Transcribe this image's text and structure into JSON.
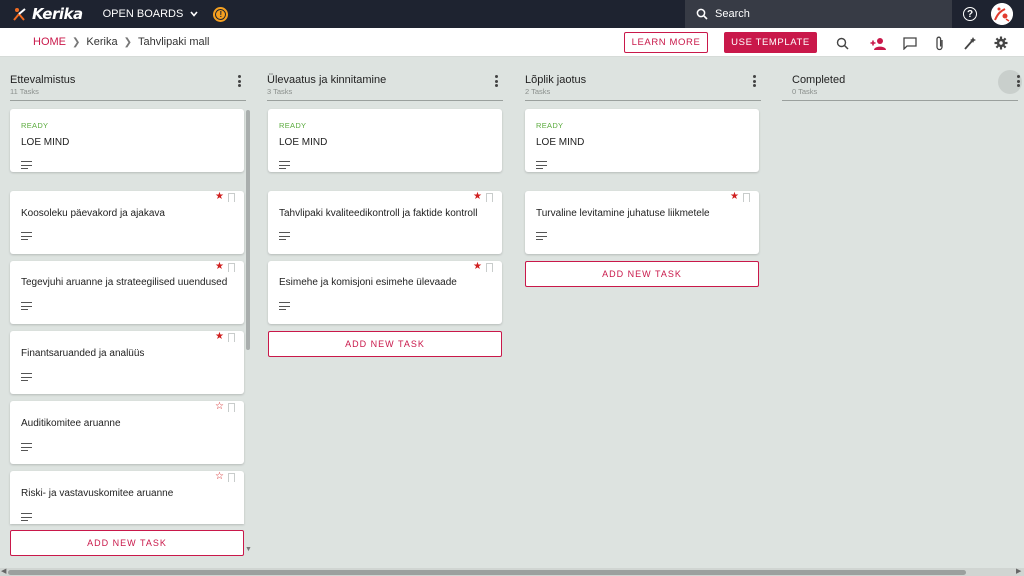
{
  "app": {
    "logo_text": "Kerika",
    "open_boards_label": "OPEN BOARDS",
    "search_placeholder": "Search",
    "help_icon": "help-circle-icon",
    "avatar_icon": "user-avatar"
  },
  "breadcrumb": [
    "HOME",
    "Kerika",
    "Tahvlipaki mall"
  ],
  "buttons": {
    "learn_more": "LEARN MORE",
    "use_template": "USE TEMPLATE"
  },
  "toolbar_icons": [
    "search-icon",
    "add-person-icon",
    "chat-icon",
    "attachment-icon",
    "magic-wand-icon",
    "settings-icon"
  ],
  "colors": {
    "accent": "#c9184a",
    "topbar": "#1e2330",
    "board_bg": "#dde3e0",
    "ready": "#5bab3e"
  },
  "columns": [
    {
      "title": "Ettevalmistus",
      "count": "11 Tasks",
      "add_label": "ADD NEW TASK",
      "cards": [
        {
          "status": "READY",
          "title": "LOE MIND",
          "starred": null
        },
        {
          "status": "",
          "title": "Koosoleku päevakord ja ajakava",
          "starred": true
        },
        {
          "status": "",
          "title": "Tegevjuhi aruanne ja strateegilised uuendused",
          "starred": true
        },
        {
          "status": "",
          "title": "Finantsaruanded ja analüüs",
          "starred": true
        },
        {
          "status": "",
          "title": "Auditikomitee aruanne",
          "starred": false
        },
        {
          "status": "",
          "title": "Riski- ja vastavuskomitee aruanne",
          "starred": false
        }
      ]
    },
    {
      "title": "Ülevaatus ja kinnitamine",
      "count": "3 Tasks",
      "add_label": "ADD NEW TASK",
      "cards": [
        {
          "status": "READY",
          "title": "LOE MIND",
          "starred": null
        },
        {
          "status": "",
          "title": "Tahvlipaki kvaliteedikontroll ja faktide kontroll",
          "starred": true
        },
        {
          "status": "",
          "title": "Esimehe ja komisjoni esimehe ülevaade",
          "starred": true
        }
      ]
    },
    {
      "title": "Lõplik jaotus",
      "count": "2 Tasks",
      "add_label": "ADD NEW TASK",
      "cards": [
        {
          "status": "READY",
          "title": "LOE MIND",
          "starred": null
        },
        {
          "status": "",
          "title": "Turvaline levitamine juhatuse liikmetele",
          "starred": true
        }
      ]
    },
    {
      "title": "Completed",
      "count": "0 Tasks",
      "add_label": "",
      "cards": []
    }
  ]
}
